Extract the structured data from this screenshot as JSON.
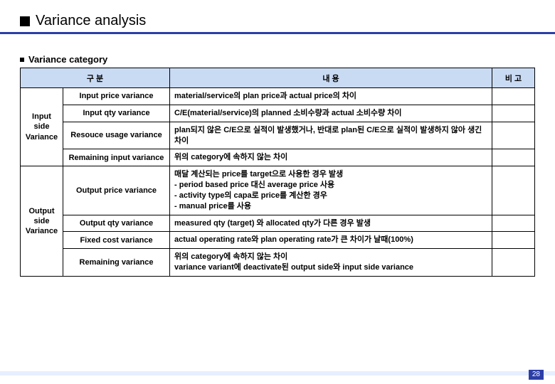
{
  "title": "Variance analysis",
  "subhead": "Variance category",
  "headers": {
    "col1": "구   분",
    "col2": "내   용",
    "col3": "비   고"
  },
  "groups": [
    {
      "name": "Input side\nVariance",
      "rows": [
        {
          "label": "Input price variance",
          "desc": "material/service의 plan price과 actual price의 차이",
          "note": ""
        },
        {
          "label": "Input qty variance",
          "desc": "C/E(material/service)의 planned 소비수량과  actual 소비수량 차이",
          "note": ""
        },
        {
          "label": "Resouce usage variance",
          "desc": "plan되지 않은 C/E으로 실적이 발생했거나, 반대로 plan된 C/E으로 실적이 발생하지 않아 생긴 차이",
          "note": ""
        },
        {
          "label": "Remaining input variance",
          "desc": "위의 category에 속하지 않는 차이",
          "note": ""
        }
      ]
    },
    {
      "name": "Output\nside\nVariance",
      "rows": [
        {
          "label": "Output price variance",
          "desc": "매달 계산되는 price를 target으로 사용한 경우 발생\n - period based price 대신 average price 사용\n - activity type의 capa로 price를 계산한 경우\n - manual price를 사용",
          "note": ""
        },
        {
          "label": "Output qty variance",
          "desc": "measured qty (target) 와 allocated qty가 다른 경우 발생",
          "note": ""
        },
        {
          "label": "Fixed cost variance",
          "desc": "actual operating rate와 plan operating rate가 큰 차이가 날때(100%)",
          "note": ""
        },
        {
          "label": "Remaining variance",
          "desc": "위의 category에 속하지 않는 차이\nvariance variant에 deactivate된 output side와 input side variance",
          "note": ""
        }
      ]
    }
  ],
  "page_number": "28"
}
